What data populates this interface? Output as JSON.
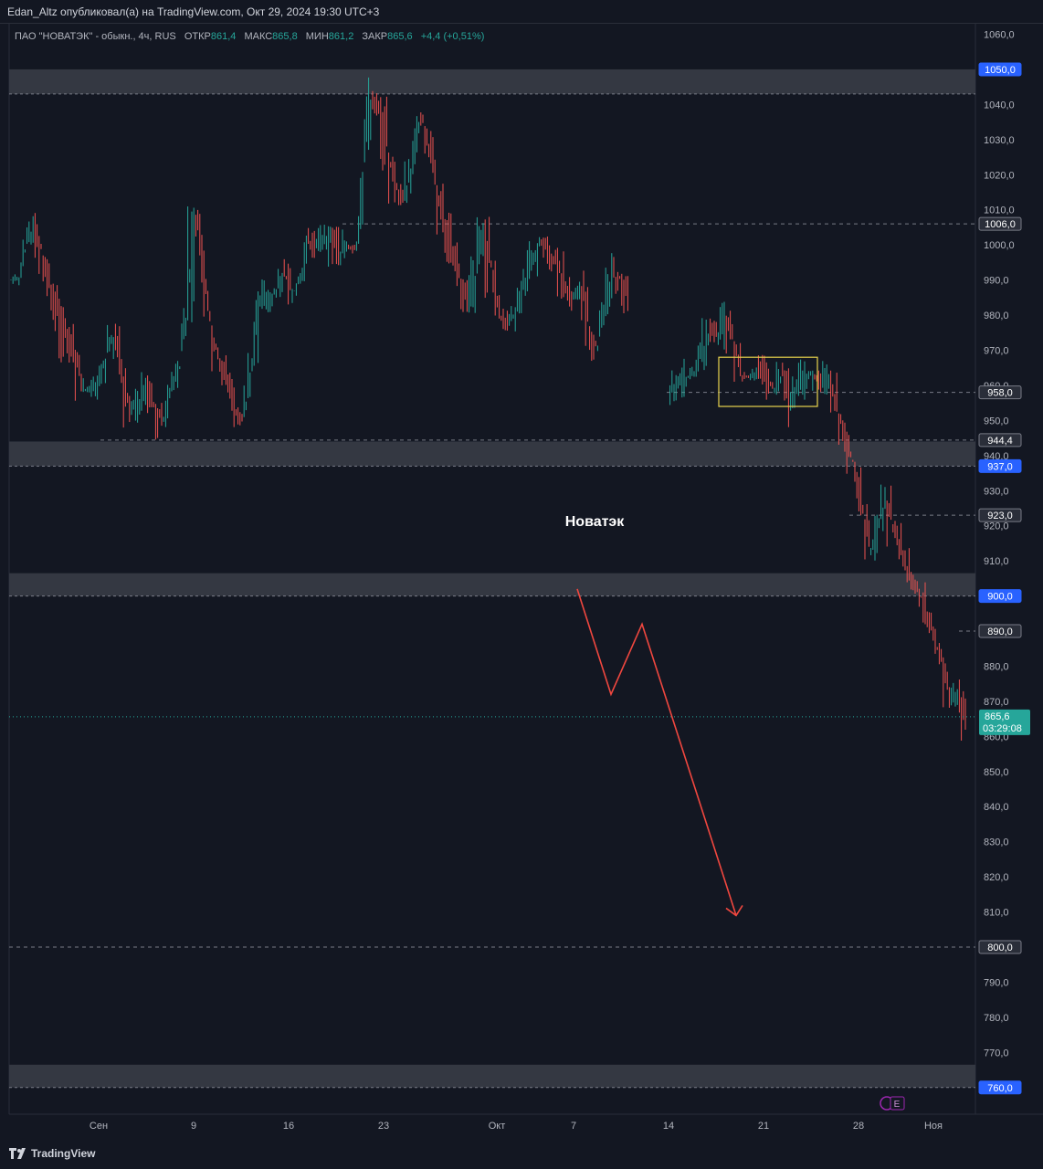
{
  "publisher_line": "Edan_Altz опубликовал(а) на TradingView.com, Окт 29, 2024 19:30 UTC+3",
  "legend": {
    "symbol": "ПАО \"НОВАТЭК\" - обыкн., 4ч, RUS",
    "open_label": "ОТКР",
    "open": "861,4",
    "high_label": "МАКС",
    "high": "865,8",
    "low_label": "МИН",
    "low": "861,2",
    "close_label": "ЗАКР",
    "close": "865,6",
    "change": "+4,4 (+0,51%)"
  },
  "annotation_text": "Новатэк",
  "footer_brand": "TradingView",
  "earnings_marker": "E",
  "colors": {
    "background": "#131722",
    "up": "#26a69a",
    "down": "#ef5350",
    "zone": "#363a45",
    "highlight_box": "#e8d44d",
    "arrow": "#f0473f",
    "price_tag_blue": "#2962ff",
    "price_tag_current": "#26a69a"
  },
  "chart_data": {
    "type": "ohlc",
    "timeframe": "4h",
    "ylim": [
      755,
      1063
    ],
    "y_ticks": [
      "1060,0",
      "1040,0",
      "1030,0",
      "1020,0",
      "1010,0",
      "1000,0",
      "990,0",
      "980,0",
      "970,0",
      "960,0",
      "950,0",
      "940,0",
      "930,0",
      "920,0",
      "910,0",
      "890,0",
      "880,0",
      "870,0",
      "860,0",
      "850,0",
      "840,0",
      "830,0",
      "820,0",
      "810,0",
      "790,0",
      "780,0",
      "770,0"
    ],
    "x_ticks": [
      "Сен",
      "9",
      "16",
      "23",
      "Окт",
      "7",
      "14",
      "21",
      "28",
      "Ноя"
    ],
    "horizontal_levels": [
      {
        "value": 1050.0,
        "label": "1050,0",
        "style": "zone",
        "zone": [
          1043,
          1050
        ]
      },
      {
        "value": 1006.0,
        "label": "1006,0",
        "style": "dashed"
      },
      {
        "value": 958.0,
        "label": "958,0",
        "style": "dashed"
      },
      {
        "value": 944.4,
        "label": "944,4",
        "style": "dashed"
      },
      {
        "value": 937.0,
        "label": "937,0",
        "style": "zone",
        "zone": [
          937,
          944
        ]
      },
      {
        "value": 923.0,
        "label": "923,0",
        "style": "dashed"
      },
      {
        "value": 900.0,
        "label": "900,0",
        "style": "zone",
        "zone": [
          900,
          906.5
        ]
      },
      {
        "value": 890.0,
        "label": "890,0",
        "style": "dashed"
      },
      {
        "value": 800.0,
        "label": "800,0",
        "style": "dashed"
      },
      {
        "value": 760.0,
        "label": "760,0",
        "style": "zone",
        "zone": [
          760,
          766.5
        ]
      }
    ],
    "current_price": {
      "value": 865.6,
      "label": "865,6",
      "countdown": "03:29:08"
    },
    "highlight_box": {
      "x_range": [
        "Окт 17",
        "Окт 25"
      ],
      "y_range": [
        954,
        968
      ]
    },
    "projection_path": [
      {
        "x": "Окт 7",
        "y": 902
      },
      {
        "x": "Окт 10",
        "y": 872
      },
      {
        "x": "Окт 12",
        "y": 892
      },
      {
        "x": "Окт 20",
        "y": 809
      }
    ],
    "series_anchor_closes": [
      [
        0,
        990
      ],
      [
        2,
        1010
      ],
      [
        4,
        988
      ],
      [
        6,
        975
      ],
      [
        8,
        958
      ],
      [
        10,
        962
      ],
      [
        12,
        973
      ],
      [
        14,
        954
      ],
      [
        16,
        960
      ],
      [
        18,
        950
      ],
      [
        20,
        968
      ],
      [
        22,
        1005
      ],
      [
        24,
        978
      ],
      [
        26,
        958
      ],
      [
        28,
        952
      ],
      [
        30,
        982
      ],
      [
        32,
        990
      ],
      [
        34,
        986
      ],
      [
        36,
        1000
      ],
      [
        38,
        1003
      ],
      [
        40,
        999
      ],
      [
        42,
        1002
      ],
      [
        44,
        1045
      ],
      [
        46,
        1025
      ],
      [
        48,
        1012
      ],
      [
        50,
        1035
      ],
      [
        52,
        1018
      ],
      [
        54,
        1000
      ],
      [
        56,
        985
      ],
      [
        58,
        1003
      ],
      [
        60,
        975
      ],
      [
        62,
        983
      ],
      [
        64,
        997
      ],
      [
        66,
        999
      ],
      [
        68,
        990
      ],
      [
        70,
        985
      ],
      [
        72,
        973
      ],
      [
        74,
        988
      ],
      [
        76,
        985
      ]
    ],
    "series_anchor_closes_2": [
      [
        82,
        956
      ],
      [
        84,
        962
      ],
      [
        86,
        975
      ],
      [
        88,
        980
      ],
      [
        90,
        965
      ],
      [
        92,
        962
      ],
      [
        94,
        960
      ],
      [
        96,
        958
      ],
      [
        98,
        962
      ],
      [
        100,
        965
      ],
      [
        102,
        952
      ],
      [
        104,
        935
      ],
      [
        106,
        915
      ],
      [
        108,
        924
      ],
      [
        110,
        915
      ],
      [
        112,
        900
      ],
      [
        114,
        885
      ],
      [
        116,
        872
      ],
      [
        118,
        865.6
      ]
    ]
  }
}
